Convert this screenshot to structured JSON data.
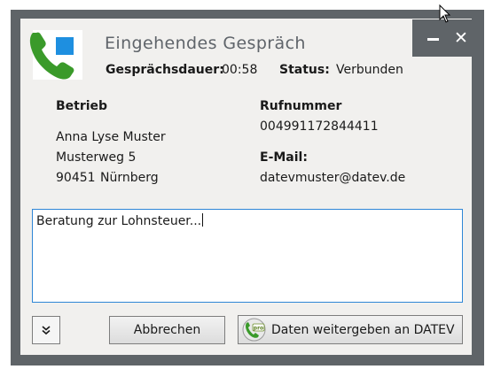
{
  "window": {
    "title": "Eingehendes Gespräch",
    "minimize_icon": "minimize-icon",
    "close_icon": "close-icon",
    "frame_color": "#5f6468",
    "background_color": "#f1f0ee"
  },
  "call": {
    "duration_label": "Gesprächsdauer:",
    "duration_value": "00:58",
    "status_label": "Status:",
    "status_value": "Verbunden"
  },
  "company": {
    "label": "Betrieb",
    "name": "Anna Lyse Muster",
    "street": "Musterweg 5",
    "postal_code": "90451",
    "city": "Nürnberg"
  },
  "phone": {
    "label": "Rufnummer",
    "value": "004991172844411"
  },
  "email": {
    "label": "E-Mail:",
    "value": "datevmuster@datev.de"
  },
  "notes": {
    "text": "Beratung zur Lohnsteuer..."
  },
  "buttons": {
    "expand_icon": "double-chevron-down-icon",
    "cancel_label": "Abbrechen",
    "forward_label": "Daten weitergeben an DATEV",
    "forward_icon": "datev-pro-icon"
  },
  "colors": {
    "accent_green": "#3a9a2a",
    "accent_blue": "#1e8fe0",
    "focus_border": "#2e86d6"
  }
}
